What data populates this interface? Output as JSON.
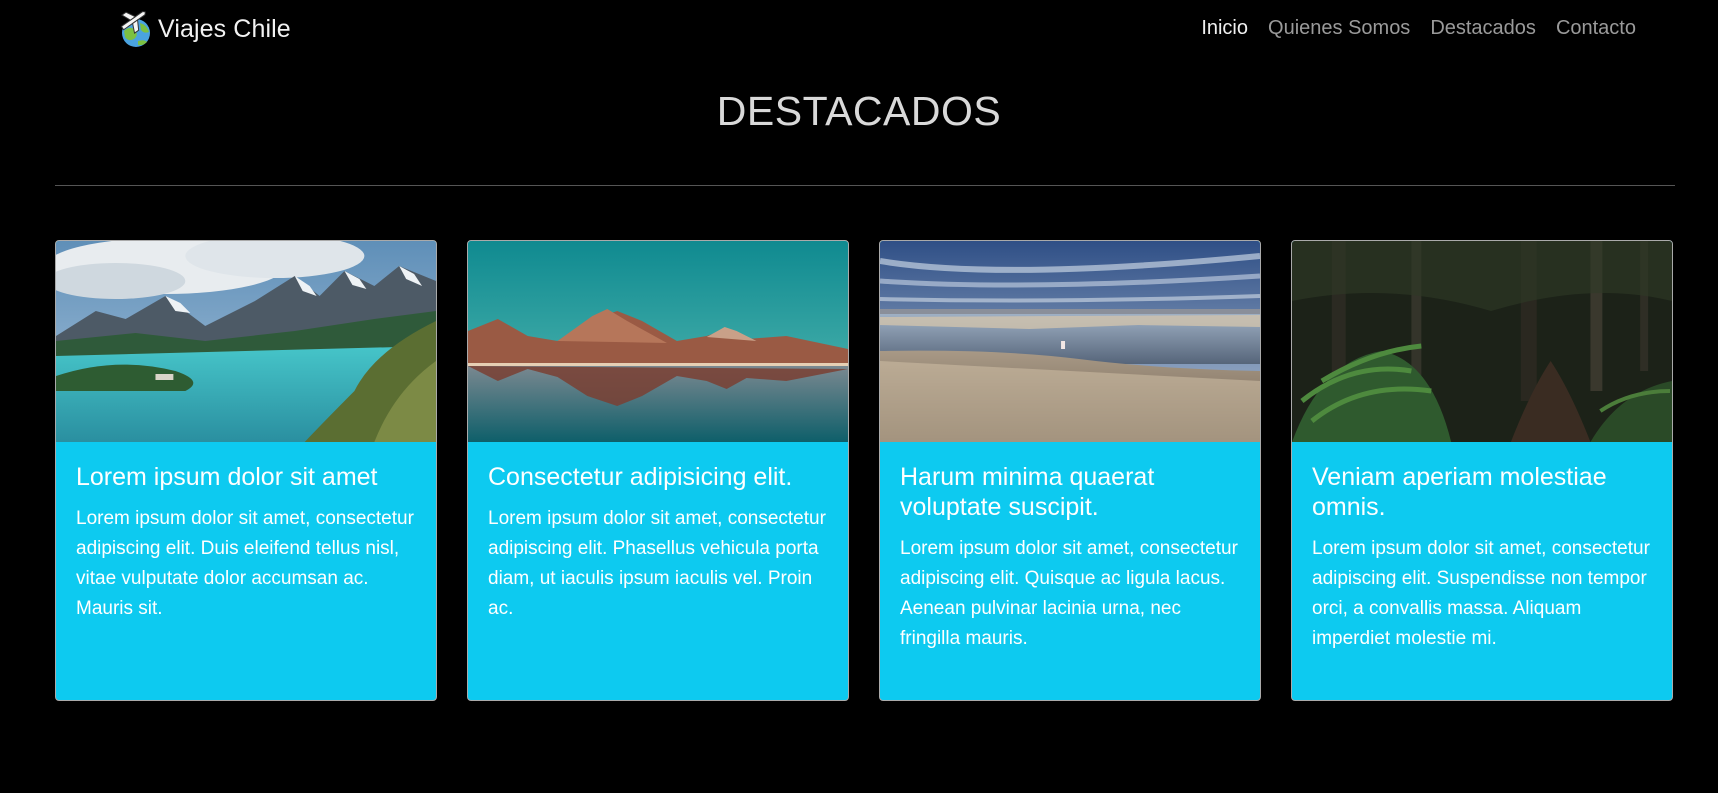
{
  "brand": {
    "name": "Viajes Chile",
    "logo_icon": "travel-globe-icon"
  },
  "nav": [
    {
      "label": "Inicio",
      "active": true
    },
    {
      "label": "Quienes Somos",
      "active": false
    },
    {
      "label": "Destacados",
      "active": false
    },
    {
      "label": "Contacto",
      "active": false
    }
  ],
  "section": {
    "title": "DESTACADOS"
  },
  "cards": [
    {
      "image": "photo-mountains-lake",
      "title": "Lorem ipsum dolor sit amet",
      "text": "Lorem ipsum dolor sit amet, consectetur adipiscing elit. Duis eleifend tellus nisl, vitae vulputate dolor accumsan ac. Mauris sit."
    },
    {
      "image": "photo-volcano-reflection",
      "title": "Consectetur adipisicing elit.",
      "text": "Lorem ipsum dolor sit amet, consectetur adipiscing elit. Phasellus vehicula porta diam, ut iaculis ipsum iaculis vel. Proin ac."
    },
    {
      "image": "photo-salt-flat-lagoon",
      "title": "Harum minima quaerat voluptate suscipit.",
      "text": "Lorem ipsum dolor sit amet, consectetur adipiscing elit. Quisque ac ligula lacus. Aenean pulvinar lacinia urna, nec fringilla mauris."
    },
    {
      "image": "photo-forest-ferns",
      "title": "Veniam aperiam molestiae omnis.",
      "text": "Lorem ipsum dolor sit amet, consectetur adipiscing elit. Suspendisse non tempor orci, a convallis massa. Aliquam imperdiet molestie mi."
    }
  ],
  "colors": {
    "background": "#000000",
    "card": "#0dcaf0",
    "nav_active": "#f0f0f0",
    "nav_inactive": "#9a9a9a"
  }
}
